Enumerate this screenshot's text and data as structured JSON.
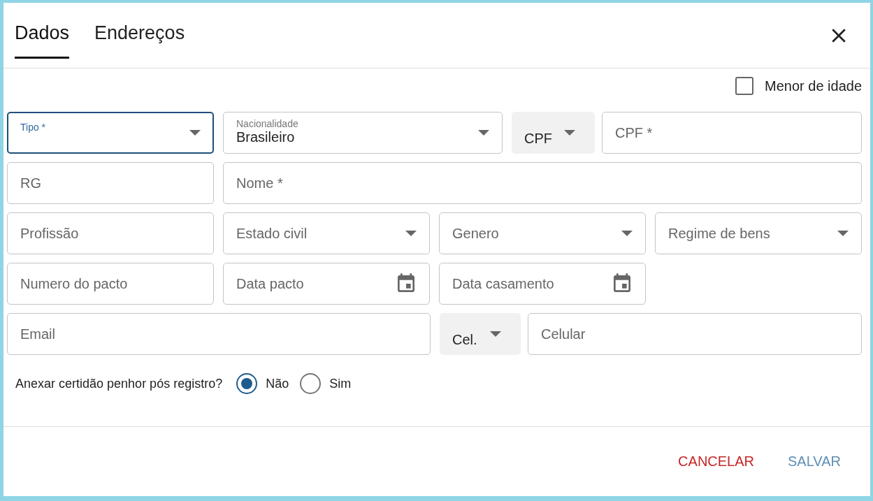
{
  "tabs": [
    {
      "label": "Dados",
      "selected": true
    },
    {
      "label": "Endereços",
      "selected": false
    }
  ],
  "minor_checkbox": {
    "label": "Menor de idade",
    "checked": false
  },
  "rows": [
    {
      "fields": [
        {
          "kind": "select",
          "label": "Tipo *",
          "focused": true
        },
        {
          "kind": "select",
          "label": "Nacionalidade",
          "value": "Brasileiro",
          "focused": false
        },
        {
          "kind": "prefix",
          "value": "CPF",
          "focused": false
        },
        {
          "kind": "text",
          "placeholder": "CPF *",
          "focused": false
        }
      ]
    },
    {
      "fields": [
        {
          "kind": "text",
          "placeholder": "RG",
          "focused": false
        },
        {
          "kind": "text",
          "placeholder": "Nome *",
          "focused": false
        }
      ]
    },
    {
      "fields": [
        {
          "kind": "text",
          "placeholder": "Profissão",
          "focused": false
        },
        {
          "kind": "select",
          "label": "Estado civil",
          "focused": false
        },
        {
          "kind": "select",
          "label": "Genero",
          "focused": false
        },
        {
          "kind": "select",
          "label": "Regime de bens",
          "focused": false
        }
      ]
    },
    {
      "fields": [
        {
          "kind": "text",
          "placeholder": "Numero do pacto",
          "focused": false
        },
        {
          "kind": "date",
          "placeholder": "Data pacto",
          "focused": false
        },
        {
          "kind": "date",
          "placeholder": "Data casamento",
          "focused": false
        }
      ]
    },
    {
      "fields": [
        {
          "kind": "text",
          "placeholder": "Email",
          "focused": false
        },
        {
          "kind": "prefix",
          "value": "Cel.",
          "focused": false
        },
        {
          "kind": "text",
          "placeholder": "Celular",
          "focused": false
        }
      ]
    }
  ],
  "radio_group": {
    "question": "Anexar certidão penhor pós registro?",
    "options": [
      {
        "label": "Não",
        "selected": true
      },
      {
        "label": "Sim",
        "selected": false
      }
    ]
  },
  "buttons": [
    {
      "label": "CANCELAR",
      "kind": "cancel"
    },
    {
      "label": "SALVAR",
      "kind": "save"
    }
  ]
}
